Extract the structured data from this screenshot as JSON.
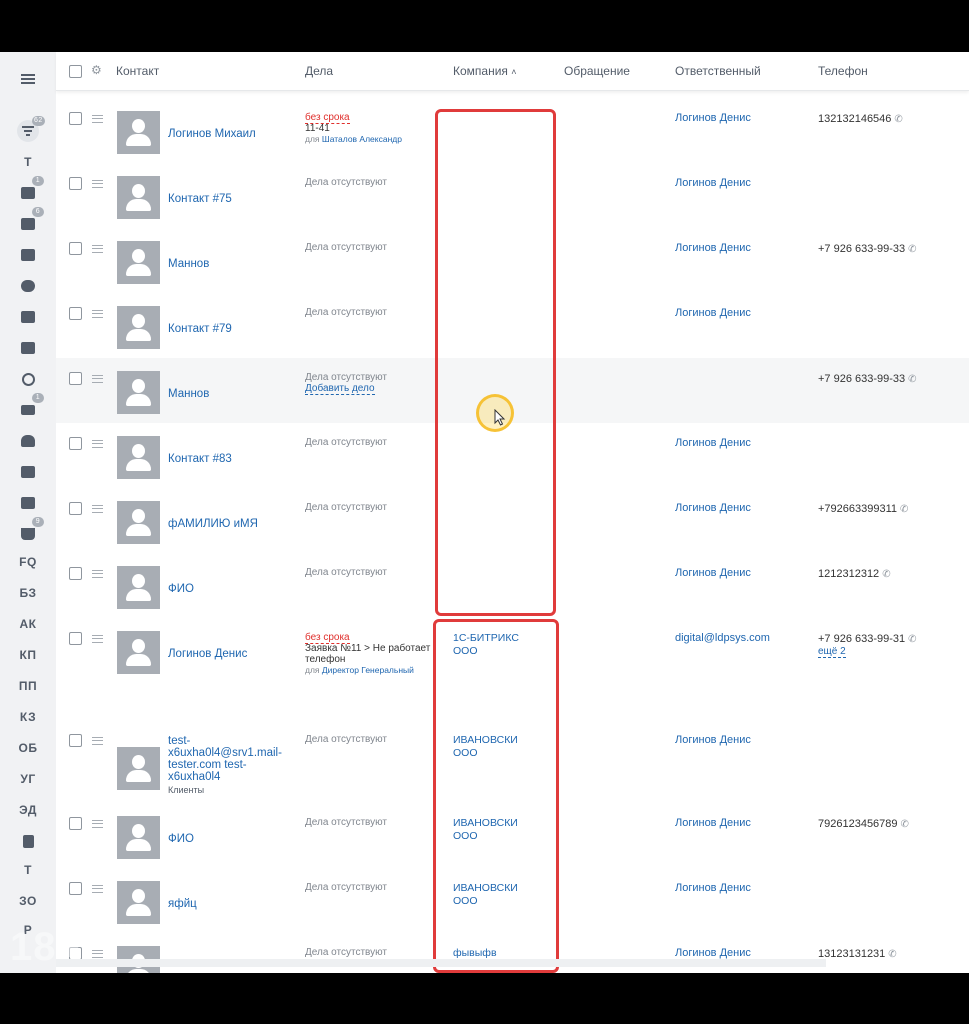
{
  "watermark": "18+",
  "sidebar": {
    "filter_badge": "62",
    "items": [
      {
        "label": "Т"
      },
      {
        "icon": "list-icon",
        "badge": "1"
      },
      {
        "icon": "task-icon",
        "badge": "6"
      },
      {
        "icon": "chat-icon"
      },
      {
        "icon": "group-icon"
      },
      {
        "icon": "drive-icon"
      },
      {
        "icon": "calendar-icon"
      },
      {
        "icon": "clock-icon"
      },
      {
        "icon": "mail-icon",
        "badge": "1"
      },
      {
        "icon": "robot-icon"
      },
      {
        "icon": "window-icon"
      },
      {
        "icon": "contact-card-icon"
      },
      {
        "icon": "cart-icon",
        "badge": "9"
      },
      {
        "label": "FQ"
      },
      {
        "label": "БЗ"
      },
      {
        "label": "АК"
      },
      {
        "label": "КП"
      },
      {
        "label": "ПП"
      },
      {
        "label": "КЗ"
      },
      {
        "label": "ОБ"
      },
      {
        "label": "УГ"
      },
      {
        "label": "ЭД"
      },
      {
        "icon": "document-icon"
      },
      {
        "label": "Т"
      },
      {
        "label": "ЗО"
      },
      {
        "label": "Р"
      }
    ]
  },
  "header": {
    "contact": "Контакт",
    "deals": "Дела",
    "company": "Компания",
    "sort_arrow": "^",
    "appeal": "Обращение",
    "responsible": "Ответственный",
    "phone": "Телефон"
  },
  "rows": [
    {
      "name": "Логинов Михаил",
      "deal_overdue": "без срока",
      "deal_text": "11-41",
      "deal_for": "для",
      "deal_for_name": "Шаталов Александр",
      "company": "",
      "responsible": "Логинов Денис",
      "phone": "132132146546"
    },
    {
      "name": "Контакт #75",
      "deal_none": "Дела отсутствуют",
      "company": "",
      "responsible": "Логинов Денис",
      "phone": ""
    },
    {
      "name": "Маннов",
      "deal_none": "Дела отсутствуют",
      "company": "",
      "responsible": "Логинов Денис",
      "phone": "+7 926 633-99-33"
    },
    {
      "name": "Контакт #79",
      "deal_none": "Дела отсутствуют",
      "company": "",
      "responsible": "Логинов Денис",
      "phone": ""
    },
    {
      "name": "Маннов",
      "deal_none": "Дела отсутствуют",
      "deal_add": "Добавить дело",
      "company": "",
      "responsible": "",
      "phone": "+7 926 633-99-33"
    },
    {
      "name": "Контакт #83",
      "deal_none": "Дела отсутствуют",
      "company": "",
      "responsible": "Логинов Денис",
      "phone": ""
    },
    {
      "name": "фАМИЛИЮ иМЯ",
      "deal_none": "Дела отсутствуют",
      "company": "",
      "responsible": "Логинов Денис",
      "phone": "+792663399311"
    },
    {
      "name": "ФИО",
      "deal_none": "Дела отсутствуют",
      "company": "",
      "responsible": "Логинов Денис",
      "phone": "1212312312"
    },
    {
      "name": "Логинов Денис",
      "deal_overdue": "без срока",
      "deal_text": "Заявка №11 > Не работает телефон",
      "deal_for": "для",
      "deal_for_name": "Директор Генеральный",
      "company": "1С-БИТРИКС ООО",
      "responsible": "digital@ldpsys.com",
      "phone": "+7 926 633-99-31",
      "phone_more": "ещё 2"
    },
    {
      "name": "test-x6uxha0l4@srv1.mail-tester.com test-x6uxha0l4",
      "name_sub": "Клиенты",
      "deal_none": "Дела отсутствуют",
      "company": "ИВАНОВСКИ ООО",
      "responsible": "Логинов Денис",
      "phone": ""
    },
    {
      "name": "ФИО",
      "deal_none": "Дела отсутствуют",
      "company": "ИВАНОВСКИ ООО",
      "responsible": "Логинов Денис",
      "phone": "7926123456789"
    },
    {
      "name": "яфйц",
      "deal_none": "Дела отсутствуют",
      "company": "ИВАНОВСКИ ООО",
      "responsible": "Логинов Денис",
      "phone": ""
    },
    {
      "name": "",
      "deal_none": "Дела отсутствуют",
      "company": "фывыфв",
      "responsible": "Логинов Денис",
      "phone": "13123131231"
    }
  ],
  "colors": {
    "link": "#2067b0",
    "overdue": "#e0302d",
    "highlight_box": "#e03b3b"
  }
}
